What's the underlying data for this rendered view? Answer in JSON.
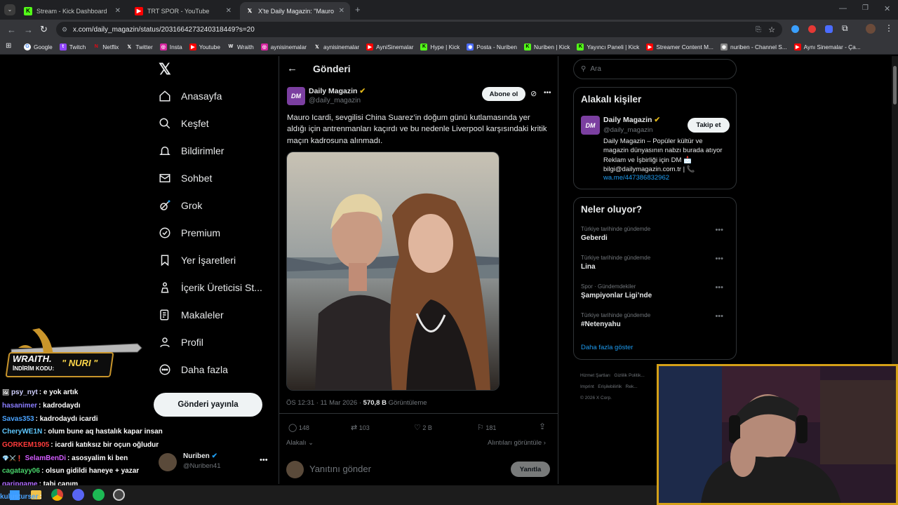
{
  "browser": {
    "tabs": [
      {
        "label": "Stream - Kick Dashboard",
        "color": "#53fc18"
      },
      {
        "label": "TRT SPOR - YouTube",
        "color": "#ff0000"
      },
      {
        "label": "X'te Daily Magazin: \"Mauro Icar...",
        "color": "#ffffff"
      }
    ],
    "url": "x.com/daily_magazin/status/2031664273240318449?s=20",
    "bookmarks": [
      "Google",
      "Twitch",
      "Netflix",
      "Twitter",
      "Insta",
      "Youtube",
      "Wraith",
      "aynisinemalar",
      "aynisinemalar",
      "AyniSinemalar",
      "Hype | Kick",
      "Posta - Nuriben",
      "Nuriben | Kick",
      "Yayıncı Paneli | Kick",
      "Streamer Content M...",
      "nuriben - Channel S...",
      "Aynı Sinemalar - Ça..."
    ]
  },
  "nav": {
    "items": [
      "Anasayfa",
      "Keşfet",
      "Bildirimler",
      "Sohbet",
      "Grok",
      "Premium",
      "Yer İşaretleri",
      "İçerik Üreticisi St...",
      "Makaleler",
      "Profil",
      "Daha fazla"
    ],
    "post_button": "Gönderi yayınla",
    "account": {
      "name": "Nuriben",
      "handle": "@Nuriben41"
    }
  },
  "post": {
    "header": "Gönderi",
    "author_name": "Daily Magazin",
    "author_handle": "@daily_magazin",
    "avatar_text": "DM",
    "subscribe": "Abone ol",
    "text": "Mauro Icardi, sevgilisi China Suarez’in doğum günü kutlamasında yer aldığı için antrenmanları kaçırdı ve bu nedenle Liverpool karşısındaki kritik maçın kadrosuna alınmadı.",
    "time": "ÖS 12:31 · 11 Mar 2026 ·",
    "views": "570,8 B",
    "views_label": "Görüntüleme",
    "replies": "148",
    "reposts": "103",
    "likes": "2 B",
    "bookmarks": "181",
    "relevant": "Alakalı",
    "quotes": "Alıntıları görüntüle",
    "reply_placeholder": "Yanıtını gönder",
    "reply_button": "Yanıtla"
  },
  "right": {
    "search_placeholder": "Ara",
    "people_title": "Alakalı kişiler",
    "person": {
      "name": "Daily Magazin",
      "handle": "@daily_magazin",
      "follow": "Takip et",
      "bio": "Daily Magazin – Popüler kültür ve magazin dünyasının nabzı burada atıyor Reklam ve İşbirliği için DM 📩 bilgi@dailymagazin.com.tr | 📞",
      "link": "wa.me/447386832962"
    },
    "trends_title": "Neler oluyor?",
    "trends": [
      {
        "meta": "Türkiye tarihinde gündemde",
        "name": "Geberdi"
      },
      {
        "meta": "Türkiye tarihinde gündemde",
        "name": "Lina"
      },
      {
        "meta": "Spor · Gündemdekiler",
        "name": "Şampiyonlar Ligi’nde"
      },
      {
        "meta": "Türkiye tarihinde gündemde",
        "name": "#Netenyahu"
      }
    ],
    "show_more": "Daha fazla göster",
    "footer": [
      "Hizmet Şartları",
      "Gizlilik Politik...",
      "Imprint",
      "Erişilebilirlik",
      "Rek...",
      "© 2026 X Corp."
    ]
  },
  "overlay": {
    "brand": "WRAITH.",
    "code_label": "İNDİRİM KODU:",
    "code": "\" NURI \""
  },
  "chat": [
    {
      "user": "psy_nyt",
      "color": "#ffffff",
      "msg": ": e yok artık"
    },
    {
      "user": "hasanimer",
      "color": "#8a7dff",
      "msg": ": kadrodaydı"
    },
    {
      "user": "Savas353",
      "color": "#4aa3ff",
      "msg": ": kadrodaydı icardi"
    },
    {
      "user": "CheryWE1N",
      "color": "#5fc8ff",
      "msg": ": olum bune aq hastalık kapar insan"
    },
    {
      "user": "GORKEM1905",
      "color": "#ff3b3b",
      "msg": ": icardi katıksız bir oçun oğludur"
    },
    {
      "user": "SelamBenDi",
      "color": "#d35bff",
      "msg": ": asosyalim ki ben"
    },
    {
      "user": "cagatayy06",
      "color": "#49d36b",
      "msg": ": olsun gidildi haneye + yazar"
    },
    {
      "user": "garipgame",
      "color": "#b06bff",
      "msg": ": tabi canım"
    },
    {
      "user": "kulusturser",
      "color": "#4aa3ff",
      "msg": ":"
    }
  ]
}
